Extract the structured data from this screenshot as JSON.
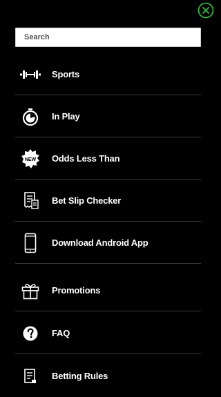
{
  "search": {
    "placeholder": "Search"
  },
  "menu": {
    "items": [
      {
        "label": "Sports",
        "icon": "dumbbell-icon"
      },
      {
        "label": "In Play",
        "icon": "stopwatch-icon"
      },
      {
        "label": "Odds Less Than",
        "icon": "new-badge-icon",
        "badge_text": "NEW"
      },
      {
        "label": "Bet Slip Checker",
        "icon": "receipt-icon"
      },
      {
        "label": "Download Android App",
        "icon": "smartphone-icon"
      },
      {
        "label": "Promotions",
        "icon": "gift-icon"
      },
      {
        "label": "FAQ",
        "icon": "question-icon"
      },
      {
        "label": "Betting Rules",
        "icon": "document-icon"
      }
    ]
  },
  "colors": {
    "accent": "#2ecc40",
    "background": "#000000",
    "separator": "#3b3b3b"
  }
}
